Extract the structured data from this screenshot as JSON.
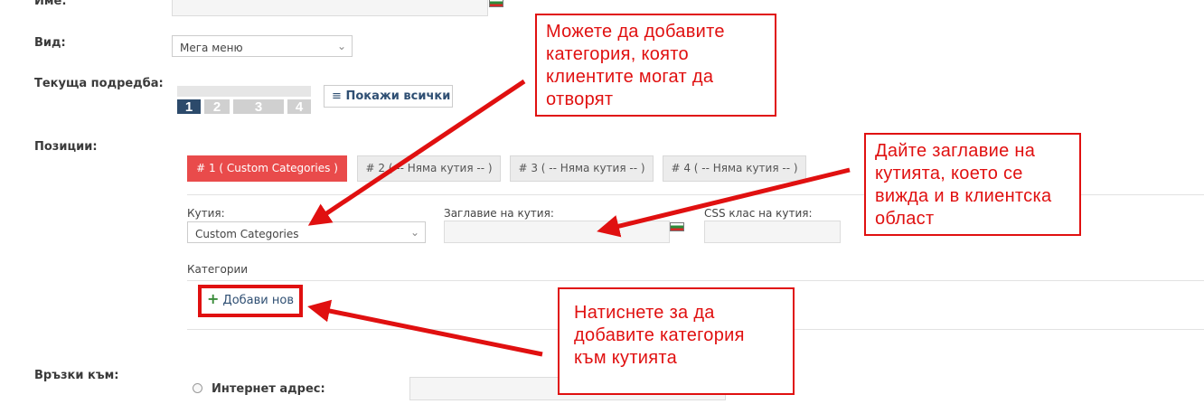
{
  "form": {
    "name_label": "Име:",
    "type_label": "Вид:",
    "type_value": "Мега меню",
    "order_label": "Текуща подредба:",
    "order_pages": [
      "1",
      "2",
      "3",
      "4"
    ],
    "show_all": "Покажи всички",
    "positions_label": "Позиции:",
    "tabs": [
      "# 1 ( Custom Categories )",
      "# 2 ( -- Няма кутия -- )",
      "# 3 ( -- Няма кутия -- )",
      "# 4 ( -- Няма кутия -- )"
    ],
    "box_label": "Кутия:",
    "box_value": "Custom Categories",
    "box_title_label": "Заглавие на кутия:",
    "css_class_label": "CSS клас на кутия:",
    "categories_label": "Категории",
    "add_new": "Добави нов",
    "links_label": "Връзки към:",
    "internet_address": "Интернет адрес:"
  },
  "annotations": {
    "note1": "Можете да добавите категория, която клиентите могат да отворят",
    "note2": "Дайте заглавие на кутията, което се вижда и в клиентска област",
    "note3": "Натиснете за да добавите категория към кутията"
  },
  "colors": {
    "active_tab": "#e94b4b",
    "annotation": "#e01010",
    "current_page": "#2c4a6b"
  }
}
